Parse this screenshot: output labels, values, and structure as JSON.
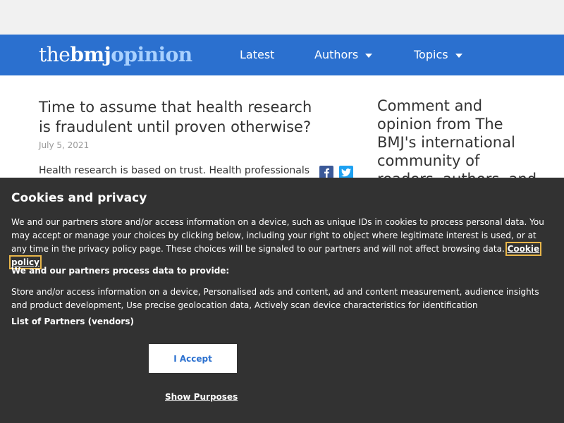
{
  "header": {
    "logo": {
      "the": "the",
      "bmj": "bmj",
      "opinion": "opinion"
    },
    "nav": [
      {
        "label": "Latest"
      },
      {
        "label": "Authors"
      },
      {
        "label": "Topics"
      }
    ]
  },
  "article": {
    "title": "Time to assume that health research is fraudulent until proven otherwise?",
    "date": "July 5, 2021",
    "body": "Health research is based on trust. Health professionals and"
  },
  "sidebar": {
    "blurb": "Comment and opinion from The BMJ's international community of readers, authors, and"
  },
  "cookie_banner": {
    "heading": "Cookies and privacy",
    "text": "We and our partners store and/or access information on a device, such as unique IDs in cookies to process personal data. You may accept or manage your choices by clicking below, including your right to object where legitimate interest is used, or at any time in the privacy policy page. These choices will be signaled to our partners and will not affect browsing data.",
    "policy_link": "Cookie policy",
    "process_heading": "We and our partners process data to provide:",
    "process_text": "Store and/or access information on a device, Personalised ads and content, ad and content measurement, audience insights and product development, Use precise geolocation data, Actively scan device characteristics for identification",
    "vendors_label": "List of Partners (vendors)",
    "accept_label": "I Accept",
    "purposes_label": "Show Purposes"
  },
  "colors": {
    "nav_background": "#2b70cf",
    "overlay_background": "#323232",
    "logo_accent": "#a9d1ff"
  },
  "icons": [
    "facebook-icon",
    "twitter-icon",
    "chevron-down-icon"
  ]
}
